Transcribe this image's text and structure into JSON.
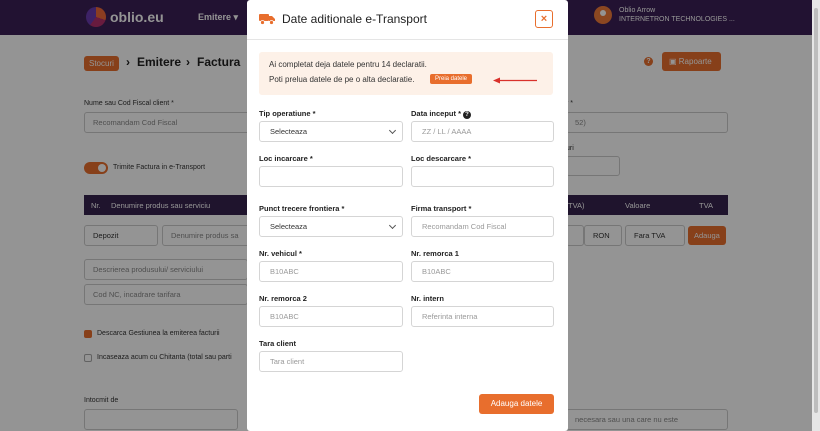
{
  "app": {
    "logo_text": "oblio.eu",
    "nav_emitere": "Emitere",
    "user_name": "Oblio Arrow",
    "user_company": "INTERNETRON TECHNOLOGIES ..."
  },
  "breadcrumb": {
    "stocuri": "Stocuri",
    "emitere": "Emitere",
    "factura": "Factura"
  },
  "header_actions": {
    "rapoarte": "Rapoarte"
  },
  "background_form": {
    "client_label": "Nume sau Cod Fiscal client *",
    "client_placeholder": "Recomandam Cod Fiscal",
    "etransport_label": "Trimite Factura in e-Transport",
    "table_nr": "Nr.",
    "table_product": "Denumire produs sau serviciu",
    "table_tva_fragment": "TVA)",
    "table_valoare": "Valoare",
    "table_tva": "TVA",
    "gestiune_select": "Depozit",
    "product_input": "Denumire produs sa",
    "currency": "RON",
    "tva_select": "Fara TVA",
    "adauga": "Adauga",
    "descriere_placeholder": "Descrierea produsului/ serviciului",
    "cod_nc_placeholder": "Cod NC, incadrare tarifara",
    "descarca_gestiune": "Descarca Gestiunea la emiterea facturii",
    "incaseaza": "Incaseaza acum cu Chitanta (total sau parti",
    "intocmit_de": "Intocmit de",
    "right_fragment_1": "52)",
    "right_fragment_2": "uri",
    "bottom_right_fragment": "necesara sau una care nu este",
    "right_label_fragment": "r *"
  },
  "modal": {
    "title": "Date aditionale e-Transport",
    "close_glyph": "×",
    "info_line1": "Ai completat deja datele pentru 14 declaratii.",
    "info_line2": "Poti prelua datele de pe o alta declaratie.",
    "preia_button": "Preia datele",
    "accent_color": "#e86e2d",
    "fields": {
      "tip_operatiune_label": "Tip operatiune *",
      "tip_operatiune_value": "Selecteaza",
      "data_inceput_label": "Data inceput *",
      "data_inceput_placeholder": "ZZ / LL / AAAA",
      "loc_incarcare_label": "Loc incarcare *",
      "loc_descarcare_label": "Loc descarcare *",
      "punct_trecere_label": "Punct trecere frontiera *",
      "punct_trecere_value": "Selecteaza",
      "firma_transport_label": "Firma transport *",
      "firma_transport_placeholder": "Recomandam Cod Fiscal",
      "nr_vehicul_label": "Nr. vehicul *",
      "nr_vehicul_placeholder": "B10ABC",
      "nr_remorca1_label": "Nr. remorca 1",
      "nr_remorca1_placeholder": "B10ABC",
      "nr_remorca2_label": "Nr. remorca 2",
      "nr_remorca2_placeholder": "B10ABC",
      "nr_intern_label": "Nr. intern",
      "nr_intern_placeholder": "Referinta interna",
      "tara_client_label": "Tara client",
      "tara_client_placeholder": "Tara client"
    },
    "submit_button": "Adauga datele"
  }
}
